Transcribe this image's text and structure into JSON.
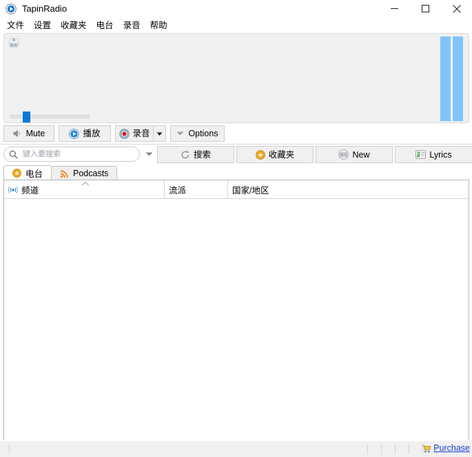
{
  "window": {
    "title": "TapinRadio",
    "app_icon": "play-circle-icon",
    "minimize_label": "—",
    "maximize_label": "□",
    "close_label": "✕"
  },
  "menubar": {
    "items": [
      {
        "label": "文件"
      },
      {
        "label": "设置"
      },
      {
        "label": "收藏夹"
      },
      {
        "label": "电台"
      },
      {
        "label": "录音"
      },
      {
        "label": "帮助"
      }
    ]
  },
  "player": {
    "station_icon": "radio-station-icon",
    "seek": {
      "value_percent": 16,
      "track_label": "seek-slider"
    },
    "vu_meters": [
      {
        "name": "vu-bar-left",
        "level_percent": 100,
        "color": "#80c4fb"
      },
      {
        "name": "vu-bar-right",
        "level_percent": 100,
        "color": "#80c4fb"
      }
    ]
  },
  "transport": {
    "mute": {
      "label": "Mute",
      "icon": "speaker-mute-icon"
    },
    "play": {
      "label": "播放",
      "icon": "play-icon"
    },
    "record": {
      "label": "录音",
      "icon": "record-icon",
      "dropdown_icon": "triangle-down-icon"
    },
    "options": {
      "label": "Options",
      "icon": "chevron-down-icon"
    }
  },
  "search": {
    "placeholder": "键入要搜索",
    "value": "",
    "icon": "search-icon",
    "history_icon": "chevron-down-icon"
  },
  "actions": {
    "search": {
      "label": "搜索",
      "icon": "search-refresh-icon"
    },
    "favorites": {
      "label": "收藏夹",
      "icon": "star-icon"
    },
    "new": {
      "label": "New",
      "icon": "radio-icon"
    },
    "lyrics": {
      "label": "Lyrics",
      "icon": "lyrics-icon"
    }
  },
  "tabs": [
    {
      "label": "电台",
      "icon": "star-icon",
      "active": true
    },
    {
      "label": "Podcasts",
      "icon": "rss-icon",
      "active": false
    }
  ],
  "list": {
    "columns": [
      {
        "label": "频道",
        "icon": "broadcast-icon",
        "sorted": "asc"
      },
      {
        "label": "流派",
        "icon": "",
        "sorted": ""
      },
      {
        "label": "国家/地区",
        "icon": "",
        "sorted": ""
      }
    ],
    "rows": []
  },
  "statusbar": {
    "panels": [
      "",
      "",
      "",
      "",
      "",
      "",
      ""
    ],
    "purchase": {
      "label": "Purchase",
      "icon": "cart-icon",
      "color": "#1a3fd0"
    }
  },
  "colors": {
    "accent_blue": "#0878d4",
    "vu_blue": "#80c4fb",
    "panel_bg": "#f0f0f0",
    "link": "#1a3fd0",
    "star_orange": "#f0a81e",
    "record_red": "#d02020"
  }
}
